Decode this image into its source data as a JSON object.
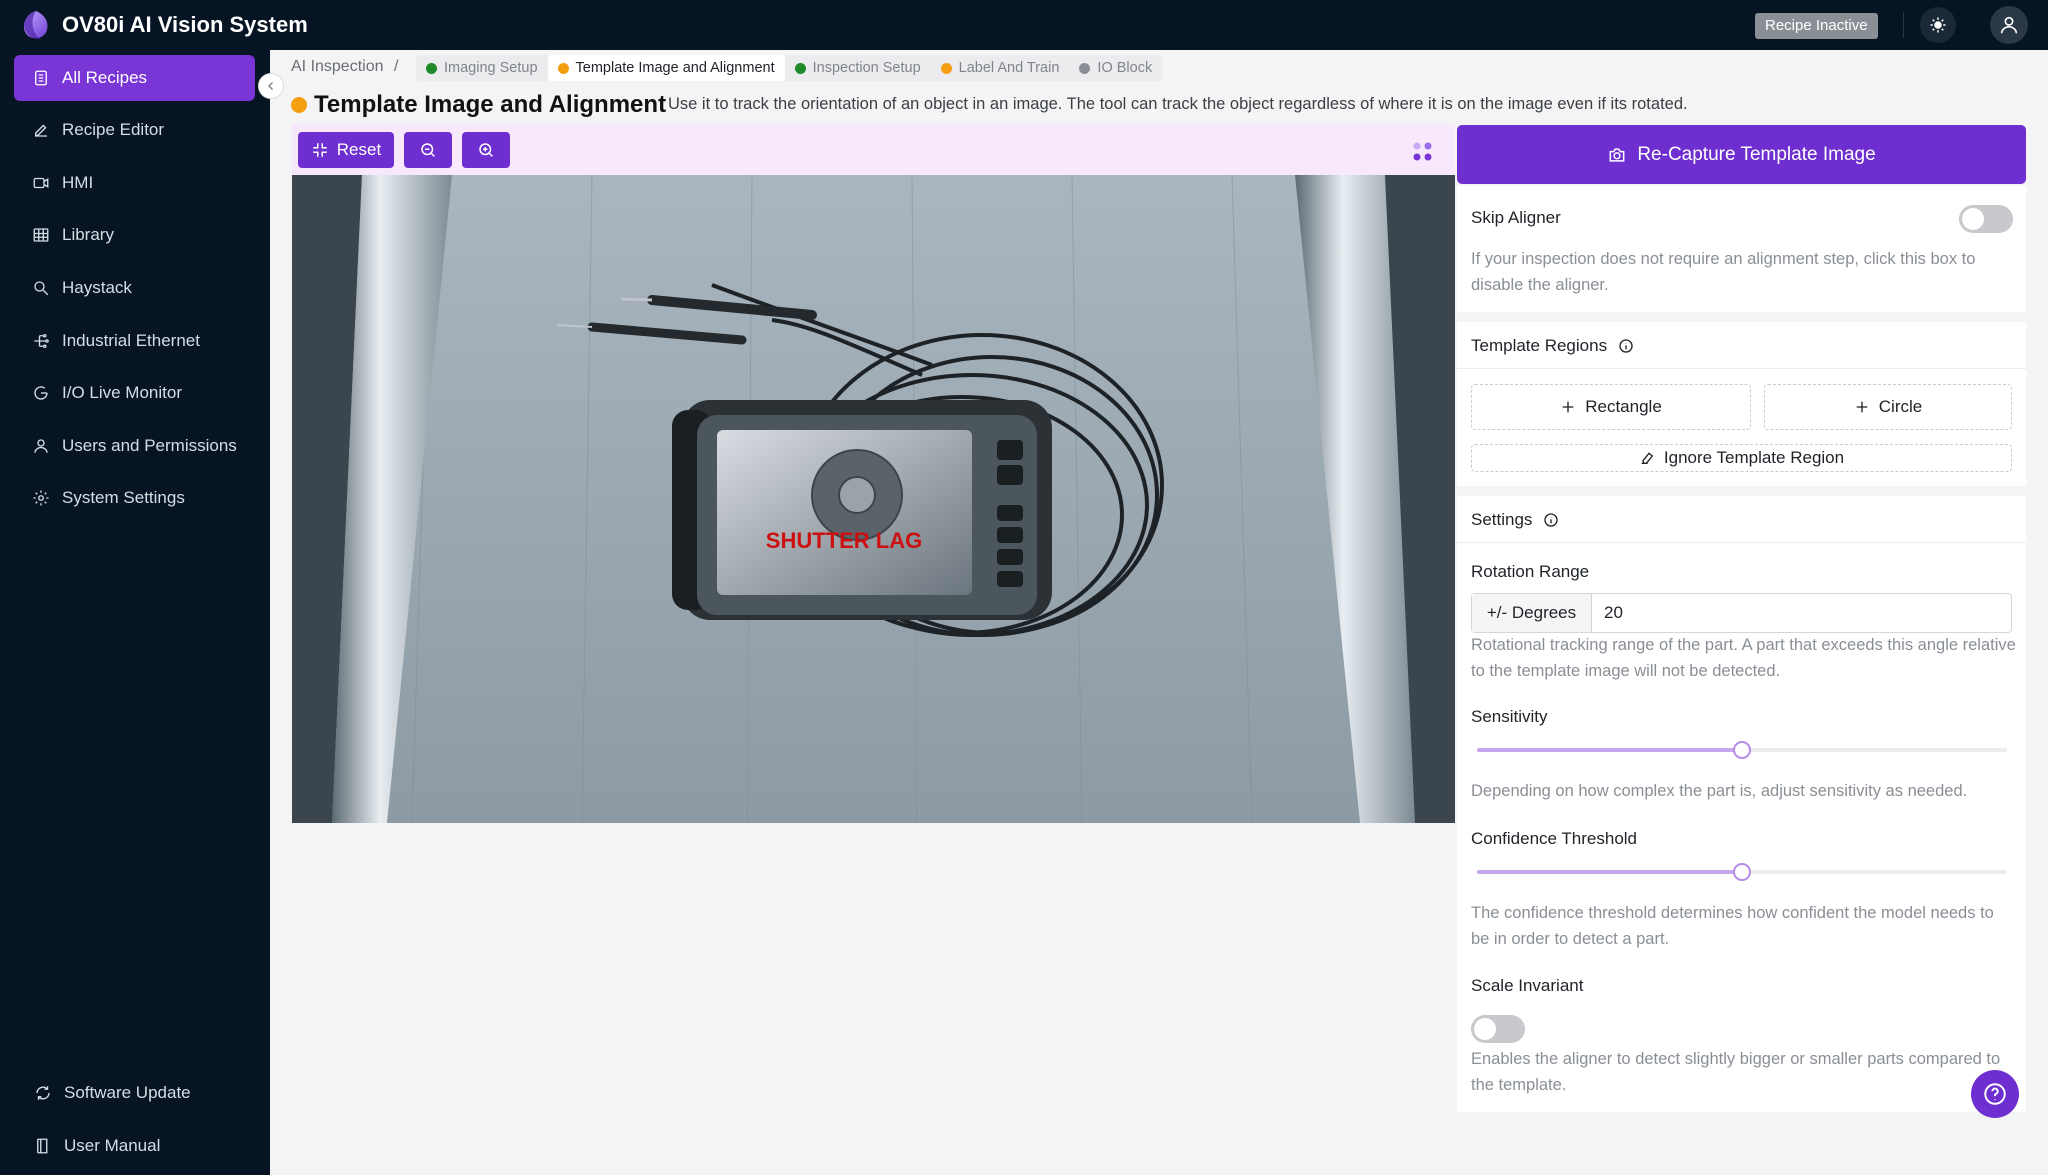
{
  "app": {
    "title": "OV80i AI Vision System",
    "recipe_status": "Recipe Inactive"
  },
  "sidebar": {
    "items": [
      {
        "label": "All Recipes",
        "icon": "document-icon",
        "active": true
      },
      {
        "label": "Recipe Editor",
        "icon": "pen-icon"
      },
      {
        "label": "HMI",
        "icon": "video-icon"
      },
      {
        "label": "Library",
        "icon": "table-icon"
      },
      {
        "label": "Haystack",
        "icon": "search-icon"
      },
      {
        "label": "Industrial Ethernet",
        "icon": "network-icon"
      },
      {
        "label": "I/O Live Monitor",
        "icon": "monitor-icon"
      },
      {
        "label": "Users and Permissions",
        "icon": "user-icon"
      },
      {
        "label": "System Settings",
        "icon": "gear-icon"
      }
    ],
    "footer": [
      {
        "label": "Software Update",
        "icon": "refresh-icon"
      },
      {
        "label": "User Manual",
        "icon": "book-icon"
      }
    ]
  },
  "breadcrumb": {
    "root": "AI Inspection",
    "separator": "/",
    "steps": [
      {
        "label": "Imaging Setup",
        "status_color": "#1f8a2a"
      },
      {
        "label": "Template Image and Alignment",
        "status_color": "#f59f10",
        "active": true
      },
      {
        "label": "Inspection Setup",
        "status_color": "#1f8a2a"
      },
      {
        "label": "Label And Train",
        "status_color": "#f59f10"
      },
      {
        "label": "IO Block",
        "status_color": "#8a8f96"
      }
    ]
  },
  "page": {
    "title": "Template Image and Alignment",
    "description": "Use it to track the orientation of an object in an image. The tool can track the object regardless of where it is on the image even if its rotated."
  },
  "toolbar": {
    "reset_label": "Reset",
    "zoom_out": "zoom-out-icon",
    "zoom_in": "zoom-in-icon"
  },
  "image": {
    "screen_text": "SHUTTER LAG"
  },
  "panel": {
    "recapture_label": "Re-Capture Template Image",
    "skip_aligner": {
      "label": "Skip Aligner",
      "enabled": false,
      "help": "If your inspection does not require an alignment step, click this box to disable the aligner."
    },
    "template_regions": {
      "label": "Template Regions",
      "rectangle_label": "Rectangle",
      "circle_label": "Circle",
      "ignore_label": "Ignore Template Region"
    },
    "settings": {
      "label": "Settings",
      "rotation_label": "Rotation Range",
      "rotation_addon": "+/- Degrees",
      "rotation_value": "20",
      "rotation_help": "Rotational tracking range of the part. A part that exceeds this angle relative to the template image will not be detected.",
      "sensitivity_label": "Sensitivity",
      "sensitivity_value": 0.5,
      "sensitivity_help": "Depending on how complex the part is, adjust sensitivity as needed.",
      "confidence_label": "Confidence Threshold",
      "confidence_value": 0.5,
      "confidence_help": "The confidence threshold determines how confident the model needs to be in order to detect a part.",
      "scale_label": "Scale Invariant",
      "scale_enabled": false,
      "scale_help": "Enables the aligner to detect slightly bigger or smaller parts compared to the template."
    }
  },
  "colors": {
    "accent": "#6f2fd0",
    "sidebar_bg": "#061424",
    "active_nav": "#7a35d6"
  }
}
